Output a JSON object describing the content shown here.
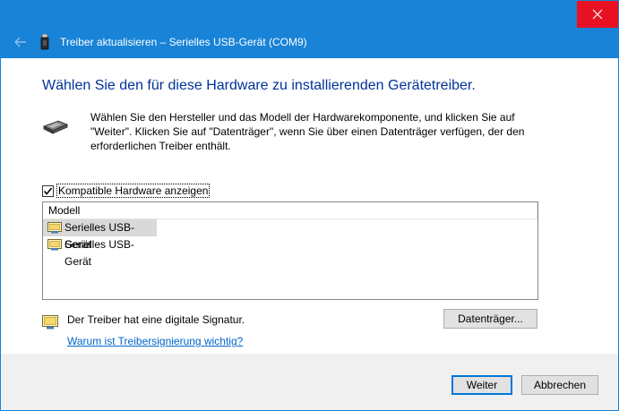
{
  "window": {
    "title": "Treiber aktualisieren – Serielles USB-Gerät (COM9)",
    "accent_color": "#1883d7",
    "close_color": "#e81123"
  },
  "content": {
    "heading": "Wählen Sie den für diese Hardware zu installierenden Gerätetreiber.",
    "description": "Wählen Sie den Hersteller und das Modell der Hardwarekomponente, und klicken Sie auf \"Weiter\". Klicken Sie auf \"Datenträger\", wenn Sie über einen Datenträger verfügen, der den erforderlichen Treiber enthält.",
    "compatible_checkbox": {
      "label": "Kompatible Hardware anzeigen",
      "checked": true
    },
    "model_list": {
      "header": "Modell",
      "items": [
        {
          "label": "Serielles USB-Gerät",
          "selected": true
        },
        {
          "label": "Serielles USB-Gerät",
          "selected": false
        }
      ]
    },
    "signature_text": "Der Treiber hat eine digitale Signatur.",
    "signature_link": "Warum ist Treibersignierung wichtig?",
    "disk_button": "Datenträger..."
  },
  "footer": {
    "next_button": "Weiter",
    "cancel_button": "Abbrechen"
  },
  "icons": {
    "back": "back-arrow-icon",
    "close": "close-icon",
    "device": "usb-device-icon",
    "hardware": "cable-connector-icon",
    "driver": "driver-certificate-icon"
  }
}
